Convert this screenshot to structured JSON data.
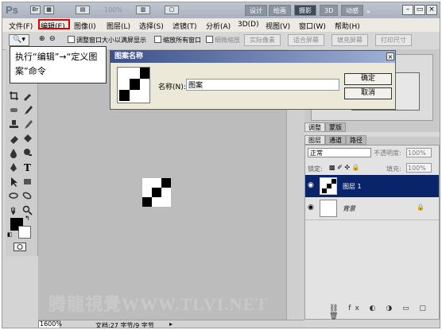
{
  "app": {
    "logo": "Ps"
  },
  "titlebar": {
    "zoom": "100%",
    "workspaces": [
      "设计",
      "绘画",
      "摄影",
      "3D",
      "动感"
    ],
    "active_workspace": 2
  },
  "menu": {
    "items": [
      "文件(F)",
      "编辑(E)",
      "图像(I)",
      "图层(L)",
      "选择(S)",
      "滤镜(T)",
      "分析(A)",
      "3D(D)",
      "视图(V)",
      "窗口(W)",
      "帮助(H)"
    ],
    "highlighted": 1
  },
  "options": {
    "check1": "调整窗口大小以满屏显示",
    "check2": "缩放所有窗口",
    "check3": "细微缩放",
    "btn_actual": "实际像素",
    "btn_fit": "适合屏幕",
    "btn_fill": "填充屏幕",
    "btn_print": "打印尺寸"
  },
  "callout": {
    "text": "执行“编辑”→“定义图案”命令"
  },
  "dialog": {
    "title": "图案名称",
    "name_label": "名称(N):",
    "name_value": "图案",
    "ok": "确定",
    "cancel": "取消"
  },
  "panels": {
    "adjust_tabs": [
      "调整",
      "蒙版"
    ],
    "layer_tabs": [
      "图层",
      "通道",
      "路径"
    ],
    "blend_mode": "正常",
    "opacity_label": "不透明度:",
    "opacity": "100%",
    "lock_label": "锁定:",
    "fill_label": "填充:",
    "fill": "100%",
    "layers": [
      {
        "name": "图层 1",
        "selected": true
      },
      {
        "name": "背景",
        "selected": false
      }
    ]
  },
  "status": {
    "zoom": "1600%",
    "doc": "文档:27 字节/9 字节"
  },
  "watermark": "腾龍視覺WWW.TLVI.NET",
  "colors": {
    "selection": "#0a246a",
    "menu_highlight": "#e00000"
  }
}
